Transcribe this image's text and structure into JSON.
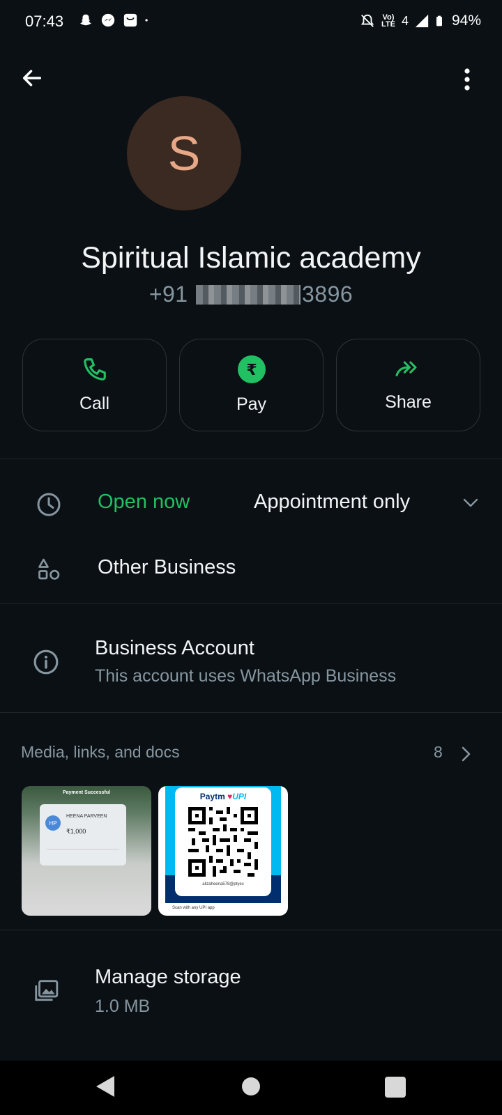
{
  "status_bar": {
    "time": "07:43",
    "battery": "94%",
    "network": "Vo) LTE",
    "signal_text": "4"
  },
  "header": {
    "back_icon": "arrow-left-icon",
    "menu_icon": "more-vert-icon"
  },
  "contact": {
    "avatar_letter": "S",
    "name": "Spiritual Islamic academy",
    "phone_prefix": "+91",
    "phone_suffix": "3896"
  },
  "actions": [
    {
      "label": "Call",
      "icon": "phone-icon"
    },
    {
      "label": "Pay",
      "icon": "rupee-icon"
    },
    {
      "label": "Share",
      "icon": "forward-icon"
    }
  ],
  "hours": {
    "status": "Open now",
    "detail": "Appointment only"
  },
  "category": "Other Business",
  "business_account": {
    "title": "Business Account",
    "subtitle": "This account uses WhatsApp Business"
  },
  "media": {
    "title": "Media, links, and docs",
    "count": "8",
    "thumb1": {
      "heading": "Payment Successful",
      "name": "HEENA PARVEEN",
      "amount": "₹1,000",
      "initials": "HP"
    },
    "thumb2": {
      "brand": "Paytm",
      "tag": "UPI",
      "upi_id": "alizaheena578@ptyes",
      "footer": "Scan with any UPI app"
    }
  },
  "storage": {
    "title": "Manage storage",
    "size": "1.0 MB"
  },
  "colors": {
    "accent_green": "#21c063",
    "background": "#0b1014",
    "secondary_text": "#8696a0"
  }
}
